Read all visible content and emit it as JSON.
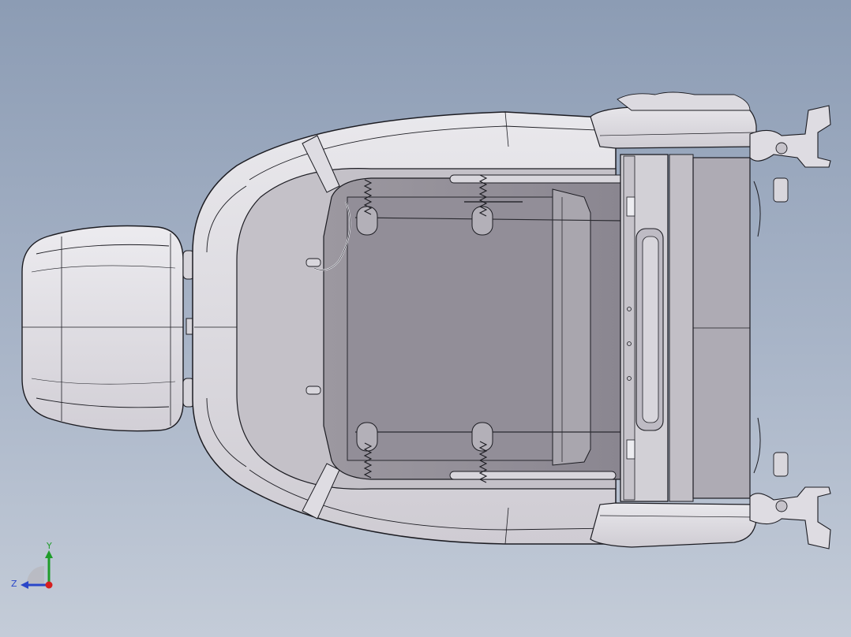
{
  "viewport": {
    "background_top": "#8c9cb4",
    "background_bottom": "#c4ccd8"
  },
  "model": {
    "description_icon": "seat-assembly-model",
    "fill_color": "#d8d6dc",
    "edge_color": "#1c1c22",
    "shade_color": "#8f8b94"
  },
  "triad": {
    "y_label": "Y",
    "z_label": "Z",
    "y_color": "#1f9c2a",
    "z_color": "#2a46c8",
    "x_color": "#d61f1f"
  }
}
